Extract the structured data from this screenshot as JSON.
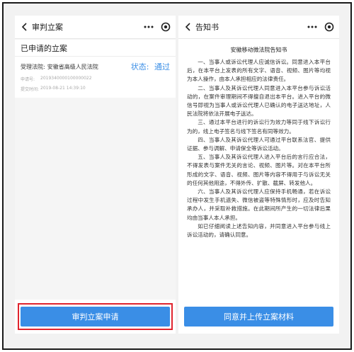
{
  "left": {
    "title": "审判立案",
    "section_header": "已申请的立案",
    "case": {
      "court_label": "受理法院:",
      "court_name": "安徽省高级人民法院",
      "status_label": "状态:",
      "status_value": "通过",
      "case_no_label": "申请号:",
      "case_no": "2019340000100000022",
      "date_label": "提交时间:",
      "date": "2019-08-21 14:39:10"
    },
    "button_label": "审判立案申请"
  },
  "right": {
    "title": "告知书",
    "heading": "安徽移动微法院告知书",
    "paragraphs": [
      "一、当事人或诉讼代理人应诚信诉讼。同意进入本平台后，在本平台上发表的所有文字、语音、视频、图片等均视为本人操作，由本人承担相应的法律责任。",
      "二、当事人及其诉讼代理人同意进入本平台参与诉讼活动的，在案件审理期间不得擅自退出本平台。进入平台的微信号即视为当事人或诉讼代理人已确认的电子送达地址，人民法院将依法开展电子送达。",
      "三、通过本平台进行的诉讼行为效力等同于线下诉讼行为的，线上电子签名与线下签名有同等效力。",
      "四、当事人及其诉讼代理人可通过平台联系法官、提供证据、参与调解、申请保全等诉讼活动。",
      "五、当事人及其诉讼代理人进入平台后的言行应合法，不得发表与案件无关的言论、视频、图片等。对在本平台所形成的文字、语音、视频、图片等内容不得用于与诉讼无关的任何其他用途，不得外传、扩散、截屏、转发他人。",
      "六、当事人及其诉讼代理人应保持手机畅通，若在诉讼过程中发生手机遗失、微信被盗等特殊情形时，应及时告知承办人，并采取补救措施。在此期间所产生的一切法律后果均由当事人本人承担。",
      "如已仔细阅读上述告知内容，并同意进入平台参与线上诉讼活动的，请确认同意。"
    ],
    "button_label": "同意并上传立案材料"
  },
  "colors": {
    "accent": "#3a8ee6",
    "highlight": "#e0242e"
  },
  "icons": [
    "back-arrow-icon",
    "more-dots-icon",
    "close-target-icon"
  ]
}
